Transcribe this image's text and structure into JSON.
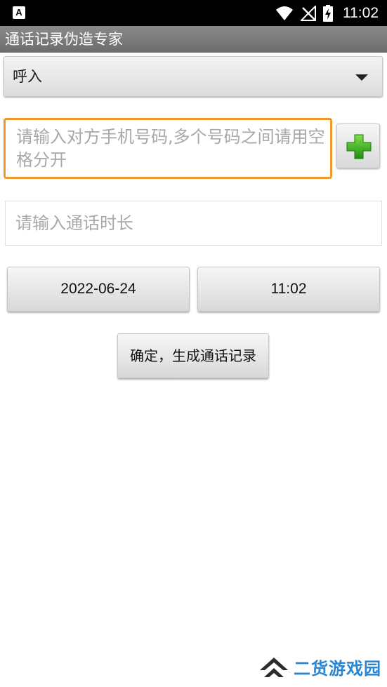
{
  "status_bar": {
    "time": "11:02",
    "notification_icon": "a-icon",
    "icons": [
      "wifi-icon",
      "no-signal-icon",
      "battery-charging-icon"
    ]
  },
  "app": {
    "title": "通话记录伪造专家"
  },
  "call_type": {
    "selected": "呼入"
  },
  "phone_input": {
    "placeholder": "请输入对方手机号码,多个号码之间请用空格分开",
    "value": ""
  },
  "add_button": {
    "icon": "plus-icon",
    "accent_color": "#3cae1e"
  },
  "duration_input": {
    "placeholder": "请输入通话时长",
    "value": ""
  },
  "date_button": {
    "label": "2022-06-24"
  },
  "time_button": {
    "label": "11:02"
  },
  "confirm_button": {
    "label": "确定，生成通话记录"
  },
  "watermark": {
    "text": "二货游戏园",
    "color": "#2a86d2"
  },
  "colors": {
    "title_bar": "#7a7a7a",
    "focus_border": "#f0982c"
  }
}
